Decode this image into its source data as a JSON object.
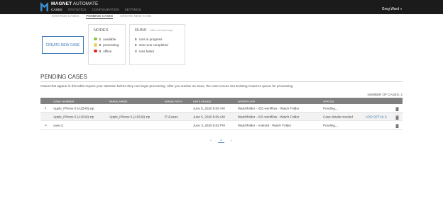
{
  "app": {
    "brand": "MAGNET",
    "product": "AUTOMATE",
    "nav": [
      "CASES",
      "STATISTICS",
      "CONFIGURATION",
      "SETTINGS"
    ],
    "user": "Greg Ward"
  },
  "subnav": [
    "EXISTING CASES",
    "PENDING CASES",
    "CREATE NEW CASE"
  ],
  "create_button": "CREATE NEW CASE",
  "nodes": {
    "title": "NODES",
    "items": [
      {
        "count": "1",
        "label": "available",
        "color": "#8dc63f"
      },
      {
        "count": "0",
        "label": "processing",
        "color": "#f0d062"
      },
      {
        "count": "0",
        "label": "offline",
        "color": "#d9281c"
      }
    ]
  },
  "runs": {
    "title": "RUNS",
    "subtitle": "Within the last 5 days",
    "items": [
      {
        "count": "0",
        "label": "runs in progress"
      },
      {
        "count": "0",
        "label": "new runs completed"
      },
      {
        "count": "3",
        "label": "runs failed"
      }
    ]
  },
  "pending": {
    "title": "PENDING CASES",
    "description": "Cases that appear in this table require your attention before they can begin processing. After you resolve an issue, the case moves into Existing Cases to queue for processing.",
    "count_label": "NUMBER OF CASES: 2",
    "columns": [
      "CASE NUMBER",
      "IMAGE NAME",
      "IMAGE PATH",
      "DATE ADDED",
      "WORKFLOW",
      "STATUS"
    ],
    "rows": [
      {
        "case": "Apple_iPhone 6 (A1549).zip",
        "image_name": "",
        "image_path": "",
        "date": "June 5, 2020 8:09 AM",
        "workflow": "Watchfolder - iOS workflow - Watch Folder",
        "status": "Pending...",
        "action": ""
      },
      {
        "case": "Apple_iPhone 6 (A1549).zip",
        "image_name": "Apple_iPhone 6 (A1549).zip",
        "image_path": "E:\\Cases",
        "date": "June 5, 2020 8:09 AM",
        "workflow": "Watchfolder - iOS workflow - Watch Folder",
        "status": "Case details needed",
        "action": "ADD DETAILS"
      },
      {
        "case": "case-2",
        "image_name": "",
        "image_path": "",
        "date": "June 3, 2020 9:02 PM",
        "workflow": "Watchfolder - Android - Watch Folder",
        "status": "Pending...",
        "action": ""
      }
    ]
  },
  "pagination": {
    "page": "1",
    "prev": "‹",
    "next": "›"
  }
}
